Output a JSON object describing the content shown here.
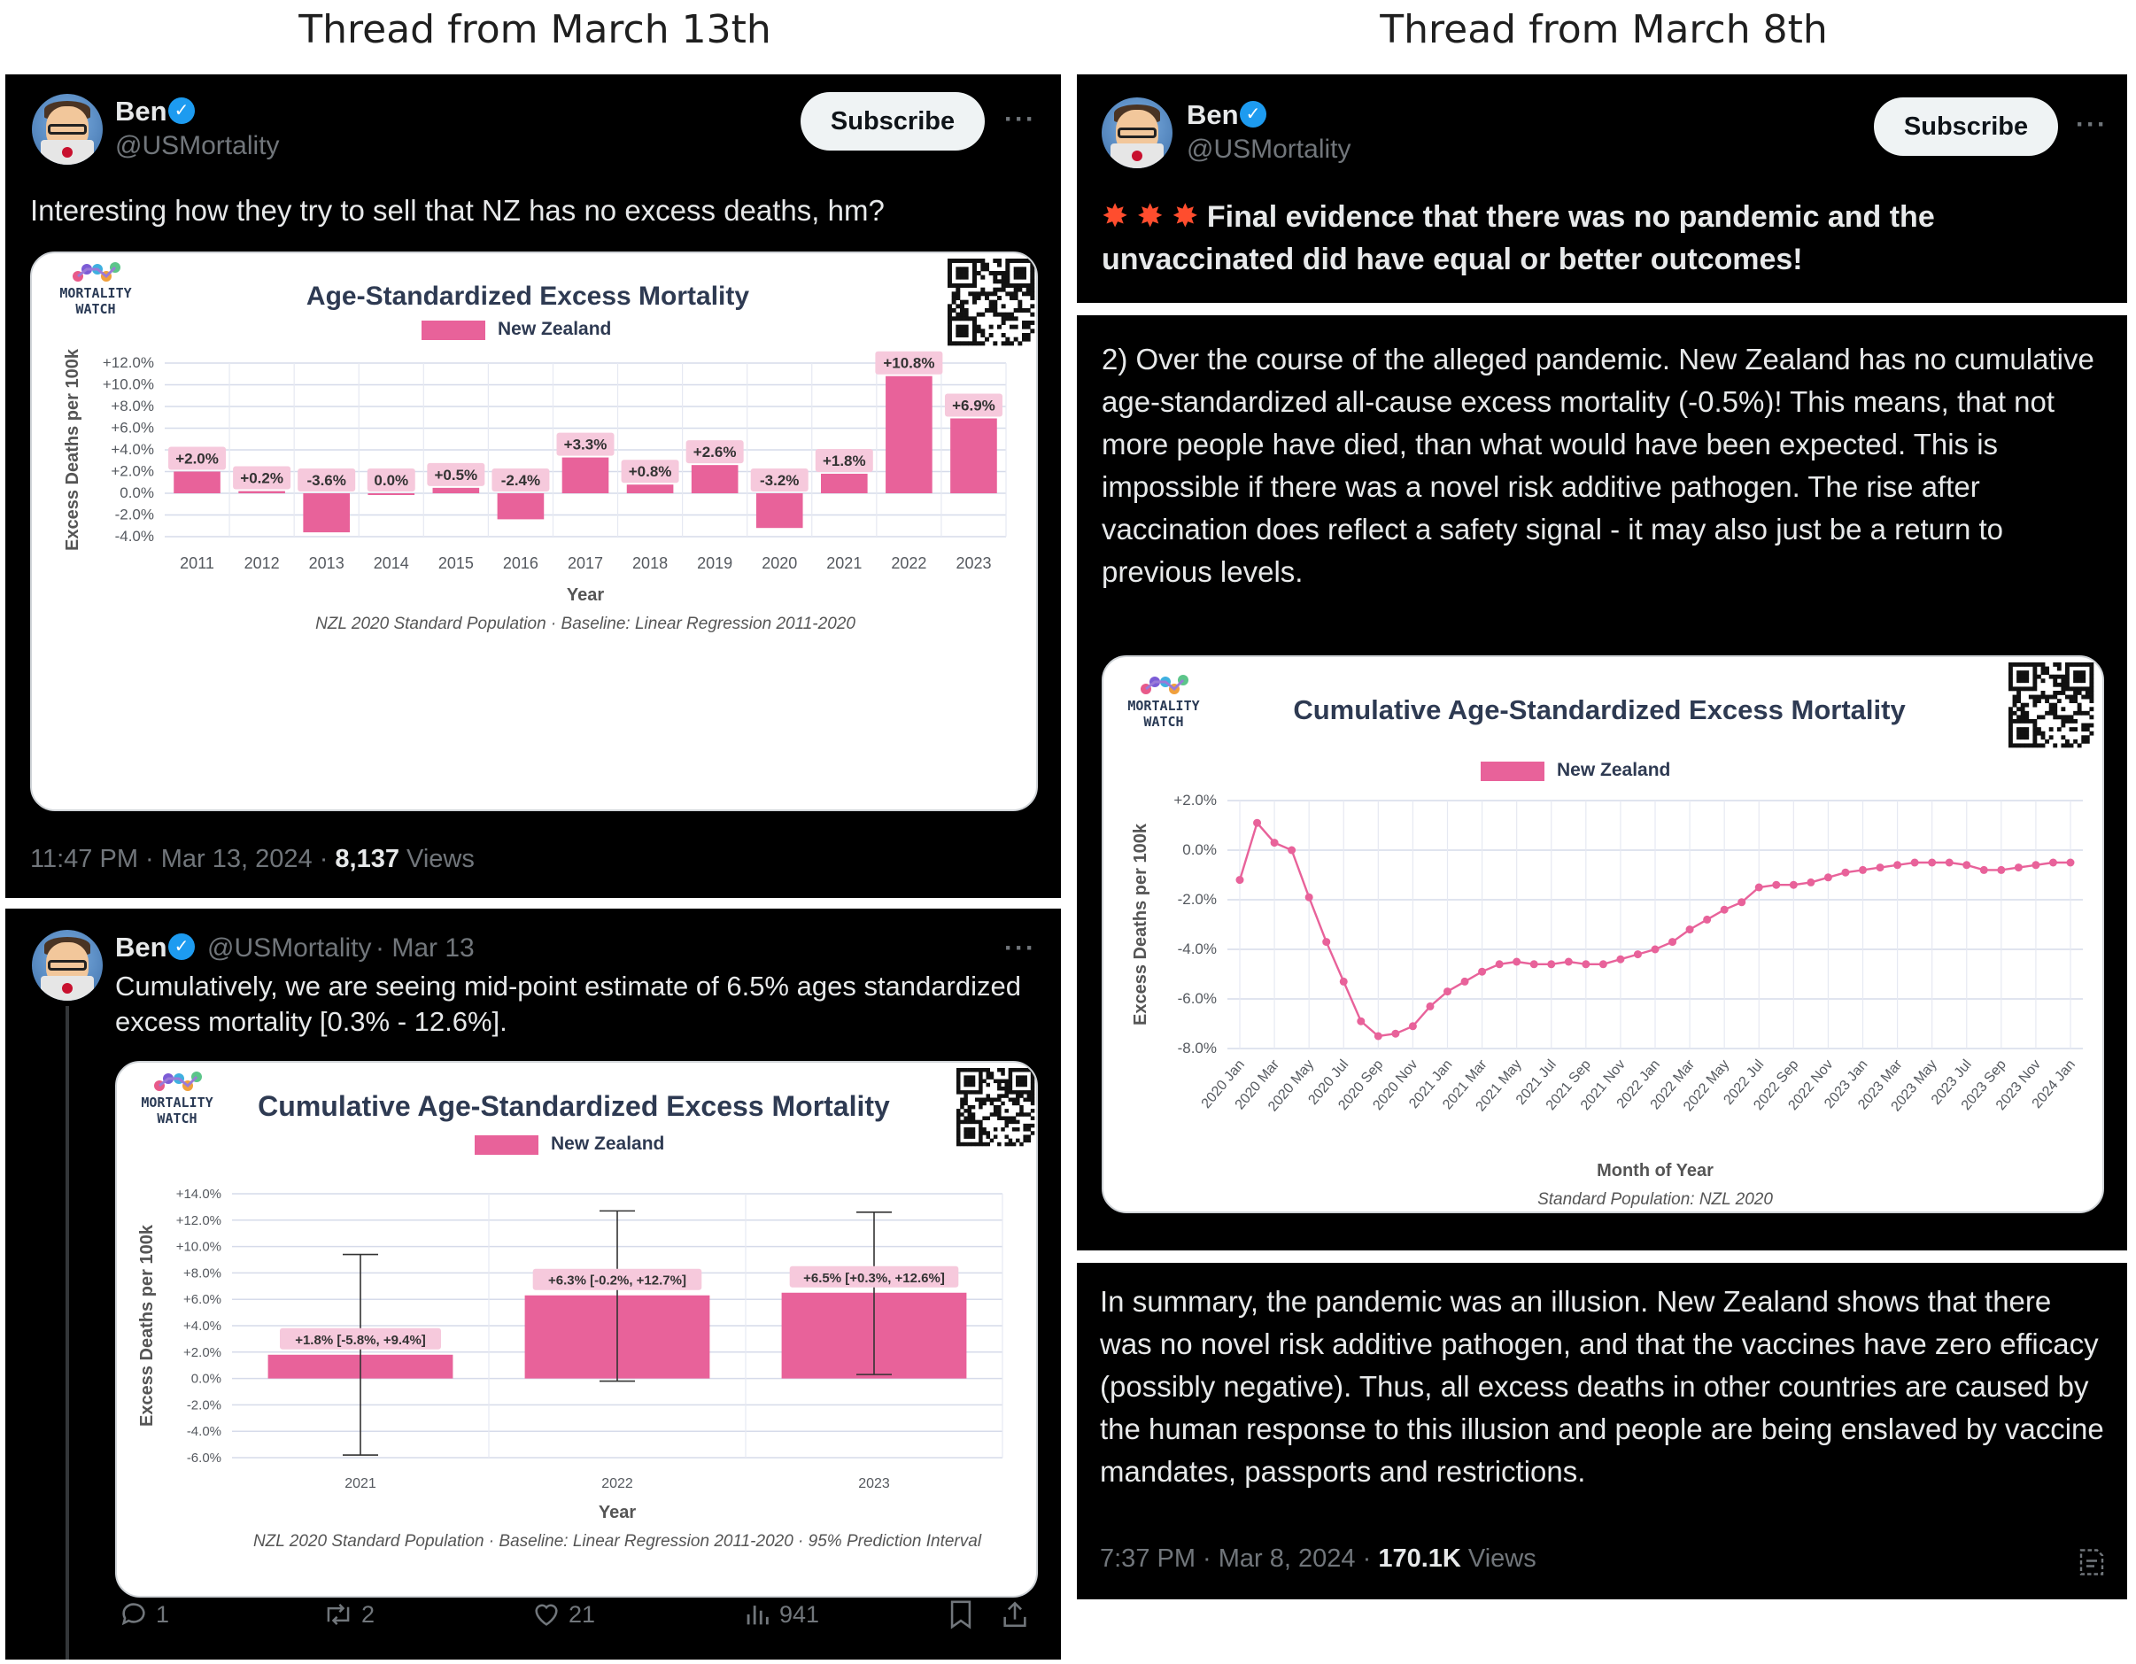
{
  "headings": {
    "left": "Thread from March 13th",
    "right": "Thread from March 8th"
  },
  "colors": {
    "bar": "#e8629a",
    "line": "#e8629a",
    "background": "#000000",
    "verified": "#1d9bf0"
  },
  "author": {
    "name": "Ben",
    "handle": "@USMortality",
    "subscribe_label": "Subscribe",
    "more_icon": "more-horizontal-icon"
  },
  "tweet1": {
    "text": "Interesting how they try to sell that NZ has no excess deaths, hm?",
    "time": "11:47 PM · Mar 13, 2024 · ",
    "views_count": "8,137",
    "views_label": " Views"
  },
  "tweet2": {
    "header_date": "· Mar 13",
    "text": "Cumulatively, we are seeing mid-point estimate of 6.5% ages standardized excess mortality [0.3% - 12.6%].",
    "replies": "1",
    "reposts": "2",
    "likes": "21",
    "views": "941"
  },
  "tweet3": {
    "text": "Final evidence that there was no pandemic and the unvaccinated did have equal or better outcomes!",
    "emoji_icon": "collision-burst-icon"
  },
  "tweet4": {
    "text": "2) Over the course of the alleged pandemic. New Zealand has no cumulative age-standardized all-cause excess mortality (-0.5%)! This means, that not more people have died, than what would have been expected. This is impossible if there was a novel risk additive pathogen. The rise after vaccination does reflect a safety signal - it may also just be a return to previous levels."
  },
  "tweet5": {
    "text": "In summary, the pandemic was an illusion. New Zealand shows that there was no novel risk additive pathogen, and that the vaccines have zero efficacy (possibly negative). Thus, all excess deaths in other countries are caused by the human response to this illusion and people are being enslaved by vaccine mandates, passports and restrictions.",
    "time": "7:37 PM · Mar 8, 2024 · ",
    "views_count": "170.1K",
    "views_label": " Views"
  },
  "chart_data": [
    {
      "type": "bar",
      "brand": "MORTALITY WATCH",
      "title": "Age-Standardized Excess Mortality",
      "legend": "New Zealand",
      "xlabel": "Year",
      "ylabel": "Excess Deaths per 100k",
      "footnote": "NZL 2020 Standard Population · Baseline: Linear Regression 2011-2020",
      "categories": [
        "2011",
        "2012",
        "2013",
        "2014",
        "2015",
        "2016",
        "2017",
        "2018",
        "2019",
        "2020",
        "2021",
        "2022",
        "2023"
      ],
      "values": [
        2.0,
        0.2,
        -3.6,
        0.0,
        0.5,
        -2.4,
        3.3,
        0.8,
        2.6,
        -3.2,
        1.8,
        10.8,
        6.9
      ],
      "labels": [
        "+2.0%",
        "+0.2%",
        "-3.6%",
        "0.0%",
        "+0.5%",
        "-2.4%",
        "+3.3%",
        "+0.8%",
        "+2.6%",
        "-3.2%",
        "+1.8%",
        "+10.8%",
        "+6.9%"
      ],
      "yticks": [
        "+12.0%",
        "+10.0%",
        "+8.0%",
        "+6.0%",
        "+4.0%",
        "+2.0%",
        "0.0%",
        "-2.0%",
        "-4.0%"
      ],
      "ylim": [
        -4,
        12
      ],
      "grid": true,
      "legend_position": "top"
    },
    {
      "type": "bar",
      "brand": "MORTALITY WATCH",
      "title": "Cumulative Age-Standardized Excess Mortality",
      "legend": "New Zealand",
      "xlabel": "Year",
      "ylabel": "Excess Deaths per 100k",
      "footnote": "NZL 2020 Standard Population · Baseline: Linear Regression 2011-2020 · 95% Prediction Interval",
      "categories": [
        "2021",
        "2022",
        "2023"
      ],
      "values": [
        1.8,
        6.3,
        6.5
      ],
      "lower": [
        -5.8,
        -0.2,
        0.3
      ],
      "upper": [
        9.4,
        12.7,
        12.6
      ],
      "labels": [
        "+1.8% [-5.8%, +9.4%]",
        "+6.3% [-0.2%, +12.7%]",
        "+6.5% [+0.3%, +12.6%]"
      ],
      "yticks": [
        "+14.0%",
        "+12.0%",
        "+10.0%",
        "+8.0%",
        "+6.0%",
        "+4.0%",
        "+2.0%",
        "0.0%",
        "-2.0%",
        "-4.0%",
        "-6.0%"
      ],
      "ylim": [
        -6,
        14
      ],
      "grid": true,
      "legend_position": "top"
    },
    {
      "type": "line",
      "brand": "MORTALITY WATCH",
      "title": "Cumulative Age-Standardized Excess Mortality",
      "legend": "New Zealand",
      "xlabel": "Month of Year",
      "ylabel": "Excess Deaths per 100k",
      "footnote": "Standard Population: NZL 2020",
      "x": [
        "2020 Jan",
        "2020 Feb",
        "2020 Mar",
        "2020 Apr",
        "2020 May",
        "2020 Jun",
        "2020 Jul",
        "2020 Aug",
        "2020 Sep",
        "2020 Oct",
        "2020 Nov",
        "2020 Dec",
        "2021 Jan",
        "2021 Feb",
        "2021 Mar",
        "2021 Apr",
        "2021 May",
        "2021 Jun",
        "2021 Jul",
        "2021 Aug",
        "2021 Sep",
        "2021 Oct",
        "2021 Nov",
        "2021 Dec",
        "2022 Jan",
        "2022 Feb",
        "2022 Mar",
        "2022 Apr",
        "2022 May",
        "2022 Jun",
        "2022 Jul",
        "2022 Aug",
        "2022 Sep",
        "2022 Oct",
        "2022 Nov",
        "2022 Dec",
        "2023 Jan",
        "2023 Feb",
        "2023 Mar",
        "2023 Apr",
        "2023 May",
        "2023 Jun",
        "2023 Jul",
        "2023 Aug",
        "2023 Sep",
        "2023 Oct",
        "2023 Nov",
        "2023 Dec",
        "2024 Jan"
      ],
      "xticks": [
        "2020 Jan",
        "2020 Mar",
        "2020 May",
        "2020 Jul",
        "2020 Sep",
        "2020 Nov",
        "2021 Jan",
        "2021 Mar",
        "2021 May",
        "2021 Jul",
        "2021 Sep",
        "2021 Nov",
        "2022 Jan",
        "2022 Mar",
        "2022 May",
        "2022 Jul",
        "2022 Sep",
        "2022 Nov",
        "2023 Jan",
        "2023 Mar",
        "2023 May",
        "2023 Jul",
        "2023 Sep",
        "2023 Nov",
        "2024 Jan"
      ],
      "values": [
        -1.2,
        1.1,
        0.3,
        0.0,
        -1.9,
        -3.7,
        -5.3,
        -6.9,
        -7.5,
        -7.4,
        -7.1,
        -6.3,
        -5.7,
        -5.3,
        -4.9,
        -4.6,
        -4.5,
        -4.6,
        -4.6,
        -4.5,
        -4.6,
        -4.6,
        -4.4,
        -4.2,
        -4.0,
        -3.7,
        -3.2,
        -2.8,
        -2.4,
        -2.1,
        -1.5,
        -1.4,
        -1.4,
        -1.3,
        -1.1,
        -0.9,
        -0.8,
        -0.7,
        -0.6,
        -0.5,
        -0.5,
        -0.5,
        -0.6,
        -0.8,
        -0.8,
        -0.7,
        -0.6,
        -0.5,
        -0.5
      ],
      "yticks": [
        "+2.0%",
        "0.0%",
        "-2.0%",
        "-4.0%",
        "-6.0%",
        "-8.0%"
      ],
      "ylim": [
        -8,
        2
      ],
      "grid": true,
      "legend_position": "top"
    }
  ]
}
